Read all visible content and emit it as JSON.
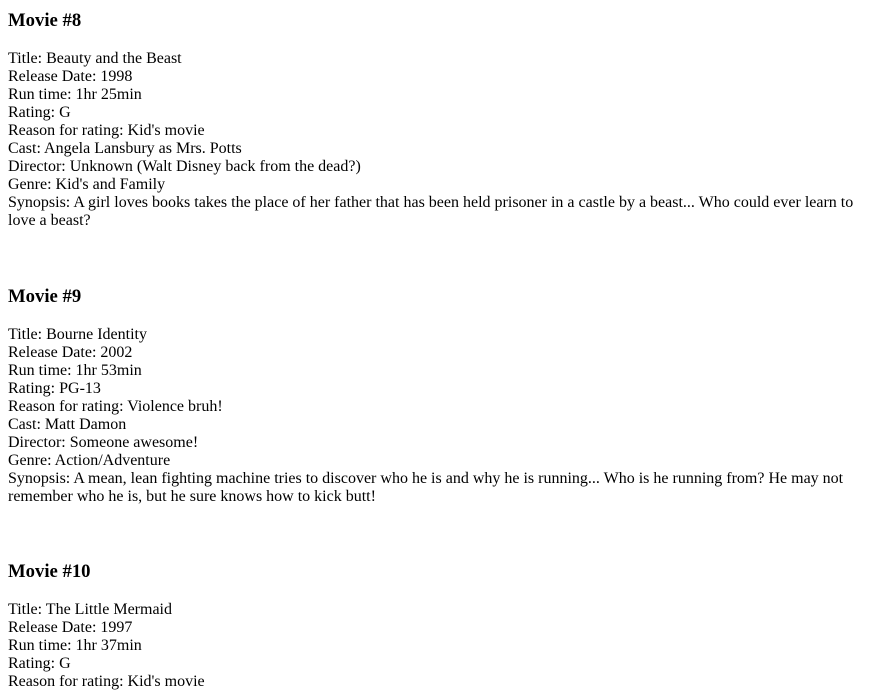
{
  "movies": [
    {
      "heading": "Movie #8",
      "fields": [
        "Title: Beauty and the Beast",
        "Release Date: 1998",
        "Run time: 1hr 25min",
        "Rating: G",
        "Reason for rating: Kid's movie",
        "Cast: Angela Lansbury as Mrs. Potts",
        "Director: Unknown (Walt Disney back from the dead?)",
        "Genre: Kid's and Family",
        "Synopsis: A girl loves books takes the place of her father that has been held prisoner in a castle by a beast... Who could ever learn to love a beast?"
      ]
    },
    {
      "heading": "Movie #9",
      "fields": [
        "Title: Bourne Identity",
        "Release Date: 2002",
        "Run time: 1hr 53min",
        "Rating: PG-13",
        "Reason for rating: Violence bruh!",
        "Cast: Matt Damon",
        "Director: Someone awesome!",
        "Genre: Action/Adventure",
        "Synopsis: A mean, lean fighting machine tries to discover who he is and why he is running... Who is he running from? He may not remember who he is, but he sure knows how to kick butt!"
      ]
    },
    {
      "heading": "Movie #10",
      "fields": [
        "Title: The Little Mermaid",
        "Release Date: 1997",
        "Run time: 1hr 37min",
        "Rating: G",
        "Reason for rating: Kid's movie"
      ]
    }
  ]
}
